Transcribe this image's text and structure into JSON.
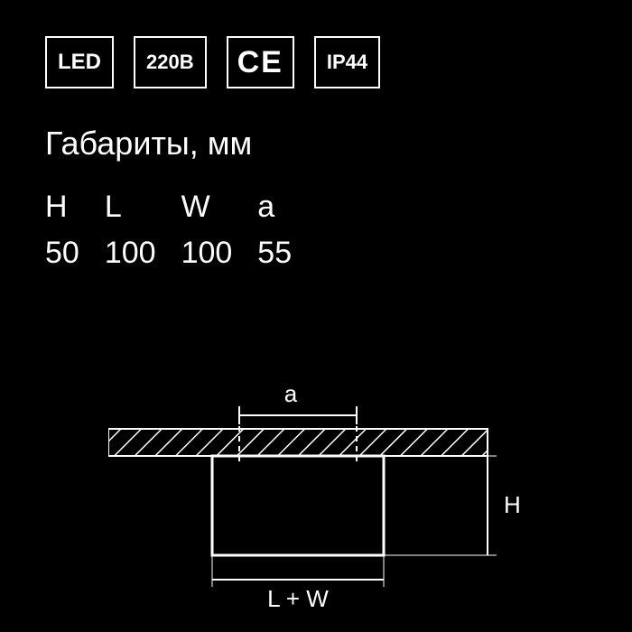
{
  "badges": {
    "led": "LED",
    "voltage": "220В",
    "ce": "CE",
    "ip": "IP44"
  },
  "dimensions_title": "Габариты, мм",
  "table": {
    "headers": [
      "H",
      "L",
      "W",
      "a"
    ],
    "values": [
      "50",
      "100",
      "100",
      "55"
    ]
  },
  "diagram_labels": {
    "a": "a",
    "H": "H",
    "LW": "L + W"
  }
}
